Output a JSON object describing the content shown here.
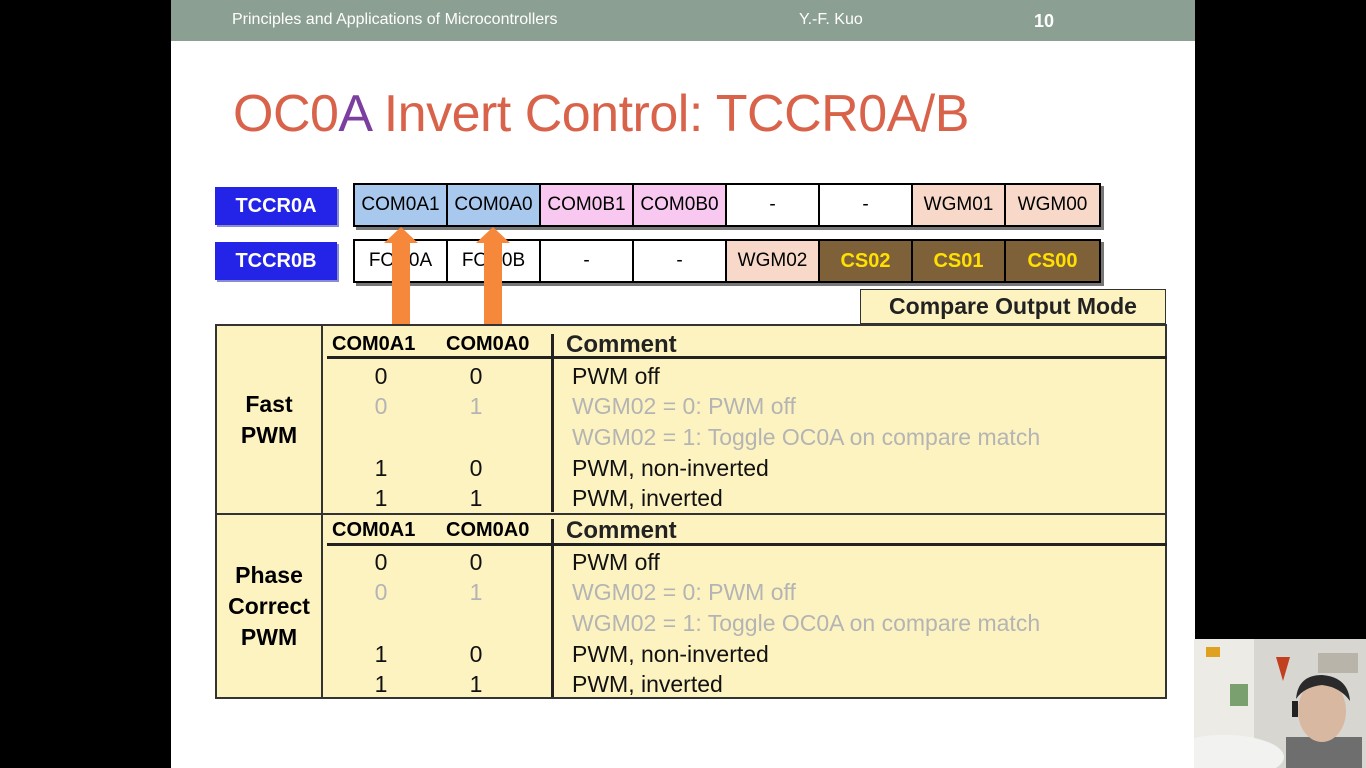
{
  "header": {
    "course": "Principles and Applications of Microcontrollers",
    "author": "Y.-F. Kuo",
    "page": "10"
  },
  "title": {
    "part1": "OC0",
    "part2": "A",
    "part3": " Invert Control: TCCR0A/B"
  },
  "registers": {
    "tccr0a": {
      "label": "TCCR0A",
      "bits": [
        "COM0A1",
        "COM0A0",
        "COM0B1",
        "COM0B0",
        "-",
        "-",
        "WGM01",
        "WGM00"
      ]
    },
    "tccr0b": {
      "label": "TCCR0B",
      "bits": [
        "FOC0A",
        "FOC0B",
        "-",
        "-",
        "WGM02",
        "CS02",
        "CS01",
        "CS00"
      ]
    }
  },
  "compare_output_mode": "Compare Output Mode",
  "table": {
    "col1": "COM0A1",
    "col2": "COM0A0",
    "col3": "Comment",
    "sections": [
      {
        "label": [
          "Fast",
          "PWM"
        ],
        "rows": [
          {
            "a1": "0",
            "a0": "0",
            "comment": "PWM off",
            "dim": false
          },
          {
            "a1": "0",
            "a0": "1",
            "comment": "WGM02 = 0: PWM off",
            "dim": true
          },
          {
            "a1": "",
            "a0": "",
            "comment": "WGM02 = 1: Toggle OC0A on compare match",
            "dim": true
          },
          {
            "a1": "1",
            "a0": "0",
            "comment": "PWM, non-inverted",
            "dim": false
          },
          {
            "a1": "1",
            "a0": "1",
            "comment": "PWM, inverted",
            "dim": false
          }
        ]
      },
      {
        "label": [
          "Phase",
          "Correct",
          "PWM"
        ],
        "rows": [
          {
            "a1": "0",
            "a0": "0",
            "comment": "PWM off",
            "dim": false
          },
          {
            "a1": "0",
            "a0": "1",
            "comment": "WGM02 = 0: PWM off",
            "dim": true
          },
          {
            "a1": "",
            "a0": "",
            "comment": "WGM02 = 1: Toggle OC0A on compare match",
            "dim": true
          },
          {
            "a1": "1",
            "a0": "0",
            "comment": "PWM, non-inverted",
            "dim": false
          },
          {
            "a1": "1",
            "a0": "1",
            "comment": "PWM, inverted",
            "dim": false
          }
        ]
      }
    ]
  },
  "colors": {
    "title": "#d9634a",
    "title_accent": "#7b3fa0",
    "header_bar": "#8c9f93",
    "reg_label": "#2424e8",
    "table_bg": "#fdf3c0",
    "arrow": "#f5883a"
  },
  "webcam": {
    "icon": "presenter-video-icon"
  }
}
